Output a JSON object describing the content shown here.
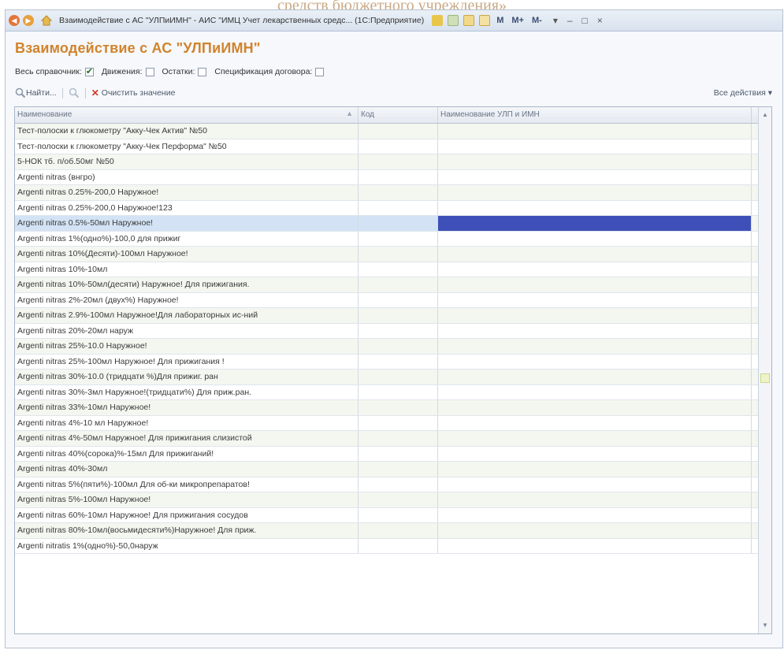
{
  "banner_text": "средств бюджетного учреждения»",
  "window": {
    "title": "Взаимодействие с АС \"УЛПиИМН\" - АИС \"ИМЦ Учет лекарственных средс... (1С:Предприятие)",
    "memory_buttons": [
      "M",
      "M+",
      "M-"
    ],
    "controls": {
      "minimize": "–",
      "close": "×"
    }
  },
  "page": {
    "title": "Взаимодействие с АС \"УЛПиИМН\""
  },
  "filters": [
    {
      "label": "Весь справочник:",
      "checked": true
    },
    {
      "label": "Движения:",
      "checked": false
    },
    {
      "label": "Остатки:",
      "checked": false
    },
    {
      "label": "Спецификация договора:",
      "checked": false
    }
  ],
  "toolbar": {
    "find_label": "Найти...",
    "clear_label": "Очистить значение",
    "all_actions_label": "Все действия ▾"
  },
  "grid": {
    "columns": [
      "Наименование",
      "Код",
      "Наименование УЛП и ИМН"
    ],
    "rows": [
      {
        "name": " Тест-полоски к глюкометру \"Акку-Чек Актив\" №50",
        "code": "",
        "ulp": ""
      },
      {
        "name": " Тест-полоски к глюкометру \"Акку-Чек Перформа\" №50",
        "code": "",
        "ulp": ""
      },
      {
        "name": "5-НОК тб. п/об.50мг №50",
        "code": "",
        "ulp": ""
      },
      {
        "name": "Argenti nitras (внгро)",
        "code": "",
        "ulp": ""
      },
      {
        "name": "Argenti nitras 0.25%-200,0 Наружное!",
        "code": "",
        "ulp": ""
      },
      {
        "name": "Argenti nitras 0.25%-200,0 Наружное!123",
        "code": "",
        "ulp": ""
      },
      {
        "name": "Argenti nitras 0.5%-50мл Наружное!",
        "code": "",
        "ulp": "",
        "selected": true
      },
      {
        "name": "Argenti nitras 1%(одно%)-100,0 для прижиг",
        "code": "",
        "ulp": ""
      },
      {
        "name": "Argenti nitras 10%(Десяти)-100мл Наружное!",
        "code": "",
        "ulp": ""
      },
      {
        "name": "Argenti nitras 10%-10мл",
        "code": "",
        "ulp": ""
      },
      {
        "name": "Argenti nitras 10%-50мл(десяти) Наружное! Для прижигания.",
        "code": "",
        "ulp": ""
      },
      {
        "name": "Argenti nitras 2%-20мл (двух%) Наружное!",
        "code": "",
        "ulp": ""
      },
      {
        "name": "Argenti nitras 2.9%-100мл Наружное!Для лабораторных ис-ний",
        "code": "",
        "ulp": ""
      },
      {
        "name": "Argenti nitras 20%-20мл наруж",
        "code": "",
        "ulp": ""
      },
      {
        "name": "Argenti nitras 25%-10.0 Наружное!",
        "code": "",
        "ulp": ""
      },
      {
        "name": "Argenti nitras 25%-100мл Наружное! Для прижигания !",
        "code": "",
        "ulp": ""
      },
      {
        "name": "Argenti nitras 30%-10.0 (тридцати %)Для прижиг. ран",
        "code": "",
        "ulp": ""
      },
      {
        "name": "Argenti nitras 30%-3мл Наружное!(тридцати%) Для приж.ран.",
        "code": "",
        "ulp": ""
      },
      {
        "name": "Argenti nitras 33%-10мл Наружное!",
        "code": "",
        "ulp": ""
      },
      {
        "name": "Argenti nitras 4%-10 мл Наружное!",
        "code": "",
        "ulp": ""
      },
      {
        "name": "Argenti nitras 4%-50мл Наружное! Для прижигания слизистой",
        "code": "",
        "ulp": ""
      },
      {
        "name": "Argenti nitras 40%(сорока)%-15мл Для прижиганий!",
        "code": "",
        "ulp": ""
      },
      {
        "name": "Argenti nitras 40%-30мл",
        "code": "",
        "ulp": ""
      },
      {
        "name": "Argenti nitras 5%(пяти%)-100мл Для об-ки микропрепаратов!",
        "code": "",
        "ulp": ""
      },
      {
        "name": "Argenti nitras 5%-100мл Наружное!",
        "code": "",
        "ulp": ""
      },
      {
        "name": "Argenti nitras 60%-10мл   Наружное!  Для прижигания сосудов",
        "code": "",
        "ulp": ""
      },
      {
        "name": "Argenti nitras 80%-10мл(восьмидесяти%)Наружное! Для приж.",
        "code": "",
        "ulp": ""
      },
      {
        "name": "Argenti nitratis 1%(одно%)-50,0наруж",
        "code": "",
        "ulp": ""
      }
    ]
  },
  "colors": {
    "title_orange": "#d1832c",
    "selection_blue": "#3e50b8",
    "selection_light": "#d3e3f5"
  }
}
